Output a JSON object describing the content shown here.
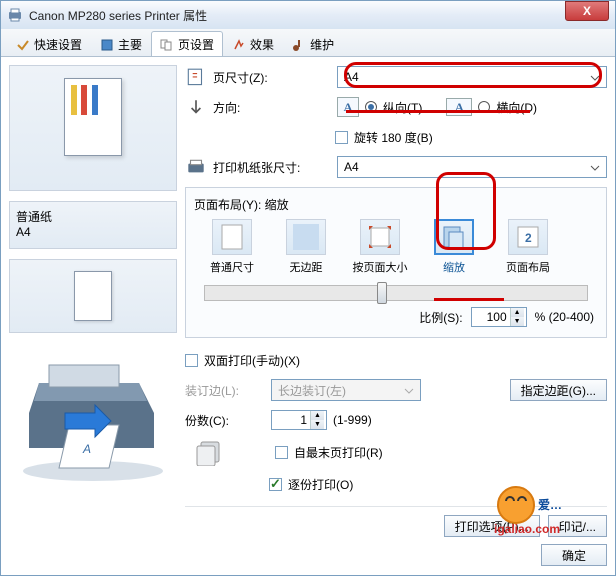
{
  "title": "Canon MP280 series Printer 属性",
  "tabs": [
    {
      "label": "快速设置"
    },
    {
      "label": "主要"
    },
    {
      "label": "页设置"
    },
    {
      "label": "效果"
    },
    {
      "label": "维护"
    }
  ],
  "paper_type": "普通纸",
  "paper_size_preview": "A4",
  "page_size": {
    "label": "页尺寸(Z):",
    "value": "A4"
  },
  "orientation": {
    "label": "方向:",
    "portrait": "纵向(T)",
    "landscape": "横向(D)",
    "selected": "portrait"
  },
  "rotate180": {
    "label": "旋转 180 度(B)",
    "checked": false
  },
  "printer_paper": {
    "label": "打印机纸张尺寸:",
    "value": "A4"
  },
  "layout": {
    "label": "页面布局(Y): 缩放",
    "options": [
      {
        "name": "普通尺寸"
      },
      {
        "name": "无边距"
      },
      {
        "name": "按页面大小"
      },
      {
        "name": "缩放"
      },
      {
        "name": "页面布局"
      }
    ],
    "selected_index": 3
  },
  "scale": {
    "label": "比例(S):",
    "value": "100",
    "suffix": "%  (20-400)"
  },
  "duplex": {
    "label": "双面打印(手动)(X)",
    "checked": false
  },
  "binding": {
    "label": "装订边(L):",
    "value": "长边装订(左)",
    "margin_btn": "指定边距(G)..."
  },
  "copies": {
    "label": "份数(C):",
    "value": "1",
    "range": "(1-999)"
  },
  "collate_last": {
    "label": "自最末页打印(R)",
    "checked": false
  },
  "collate": {
    "label": "逐份打印(O)",
    "checked": true
  },
  "print_options_btn": "打印选项(P)...",
  "stamp_btn": "印记/...",
  "ok_btn": "确定",
  "watermark_main": "爱...",
  "watermark_sub": "igaliao.com"
}
